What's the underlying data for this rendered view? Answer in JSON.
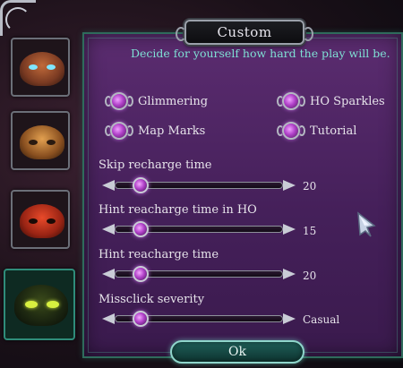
{
  "dialog": {
    "title": "Custom",
    "subtitle": "Decide for yourself how hard the play will be.",
    "ok_label": "Ok"
  },
  "options": [
    {
      "label": "Glimmering",
      "icon": "gem-toggle-icon"
    },
    {
      "label": "HO Sparkles",
      "icon": "gem-toggle-icon"
    },
    {
      "label": "Map Marks",
      "icon": "gem-toggle-icon"
    },
    {
      "label": "Tutorial",
      "icon": "gem-toggle-icon"
    }
  ],
  "sliders": [
    {
      "label": "Skip recharge time",
      "value": "20",
      "level": 0.12
    },
    {
      "label": "Hint reacharge time in HO",
      "value": "15",
      "level": 0.12
    },
    {
      "label": "Hint reacharge time",
      "value": "20",
      "level": 0.12
    },
    {
      "label": "Missclick severity",
      "value": "Casual",
      "level": 0.12
    }
  ],
  "thumbnails": [
    {
      "name": "casual-mask-icon",
      "active": false
    },
    {
      "name": "advanced-mask-icon",
      "active": false
    },
    {
      "name": "expert-mask-icon",
      "active": false
    },
    {
      "name": "custom-mask-icon",
      "active": true
    }
  ],
  "colors": {
    "panel": "#4a2460",
    "accent_teal": "#7fe0d4",
    "gem_purple": "#b040c8"
  }
}
